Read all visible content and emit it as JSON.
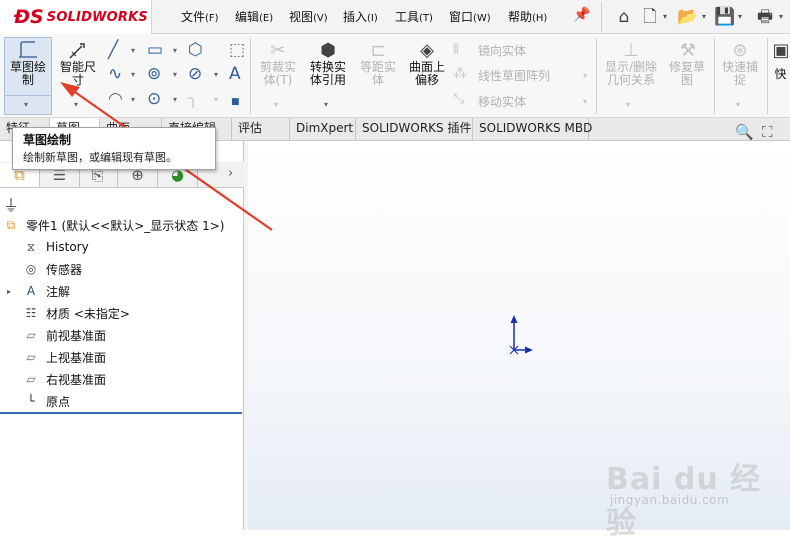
{
  "app": {
    "brand": "SOLIDWORKS",
    "accent_color": "#d6001c",
    "selection_color": "#dce6f2"
  },
  "menu": [
    {
      "label": "文件",
      "key": "(F)"
    },
    {
      "label": "编辑",
      "key": "(E)"
    },
    {
      "label": "视图",
      "key": "(V)"
    },
    {
      "label": "插入",
      "key": "(I)"
    },
    {
      "label": "工具",
      "key": "(T)"
    },
    {
      "label": "窗口",
      "key": "(W)"
    },
    {
      "label": "帮助",
      "key": "(H)"
    }
  ],
  "quick_access_icons": [
    "pin-icon",
    "home-icon",
    "new-document-icon",
    "open-folder-icon",
    "save-icon",
    "print-icon"
  ],
  "ribbon": {
    "sketch_button": {
      "label_line1": "草图绘",
      "label_line2": "制"
    },
    "smart_dimension": {
      "label_line1": "智能尺",
      "label_line2": "寸"
    },
    "trim_entities": {
      "label_line1": "剪裁实",
      "label_line2": "体(T)"
    },
    "convert_entities": {
      "label_line1": "转换实",
      "label_line2": "体引用"
    },
    "offset_entities": {
      "label_line1": "等距实",
      "label_line2": "体"
    },
    "offset_on_surface": {
      "label_line1": "曲面上",
      "label_line2": "偏移"
    },
    "mirror_entities": "镜向实体",
    "linear_pattern": "线性草图阵列",
    "move_entities": "移动实体",
    "display_delete_relations": {
      "label_line1": "显示/删除",
      "label_line2": "几何关系"
    },
    "repair_sketch": {
      "label_line1": "修复草",
      "label_line2": "图"
    },
    "quick_snaps": {
      "label_line1": "快速捕",
      "label_line2": "捉"
    },
    "rapid_sketch": {
      "label_line1": "快"
    }
  },
  "tabs": [
    "特征",
    "草图",
    "曲面",
    "直接编辑",
    "评估",
    "DimXpert",
    "SOLIDWORKS 插件",
    "SOLIDWORKS MBD"
  ],
  "active_tab": "草图",
  "tooltip": {
    "title": "草图绘制",
    "description": "绘制新草图，或编辑现有草图。"
  },
  "feature_tree": {
    "root": "零件1  (默认<<默认>_显示状态 1>)",
    "items": [
      {
        "label": "History",
        "icon": "history-icon"
      },
      {
        "label": "传感器",
        "icon": "sensor-icon"
      },
      {
        "label": "注解",
        "icon": "annotation-icon",
        "expandable": true
      },
      {
        "label": "材质 <未指定>",
        "icon": "material-icon"
      },
      {
        "label": "前视基准面",
        "icon": "plane-icon"
      },
      {
        "label": "上视基准面",
        "icon": "plane-icon"
      },
      {
        "label": "右视基准面",
        "icon": "plane-icon"
      },
      {
        "label": "原点",
        "icon": "origin-icon"
      }
    ]
  },
  "watermark": {
    "main": "Bai du 经验",
    "sub": "jingyan.baidu.com"
  }
}
